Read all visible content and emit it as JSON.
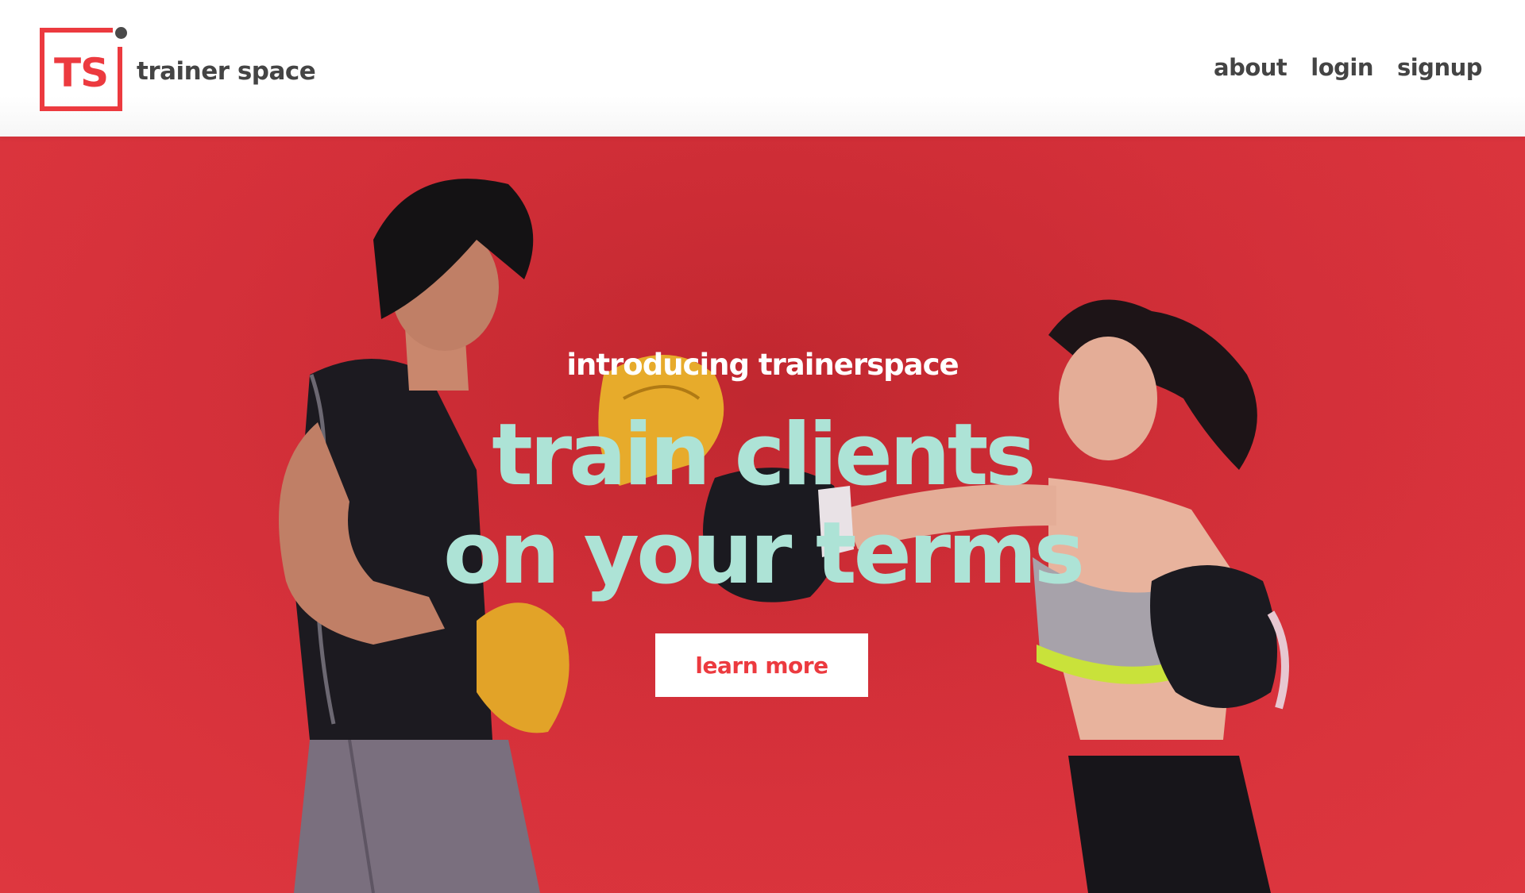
{
  "brand": {
    "mark_letters": "TS",
    "name": "trainer space",
    "accent_color": "#ec3a3f"
  },
  "nav": {
    "items": [
      {
        "label": "about"
      },
      {
        "label": "login"
      },
      {
        "label": "signup"
      }
    ]
  },
  "hero": {
    "eyebrow": "introducing trainerspace",
    "headline_line1": "train clients",
    "headline_line2": "on your terms",
    "headline_color": "#ade3d6",
    "background_color": "#d5303a",
    "cta_label": "learn more",
    "image_description_icons": [
      "male-trainer-figure",
      "female-boxer-figure"
    ]
  }
}
